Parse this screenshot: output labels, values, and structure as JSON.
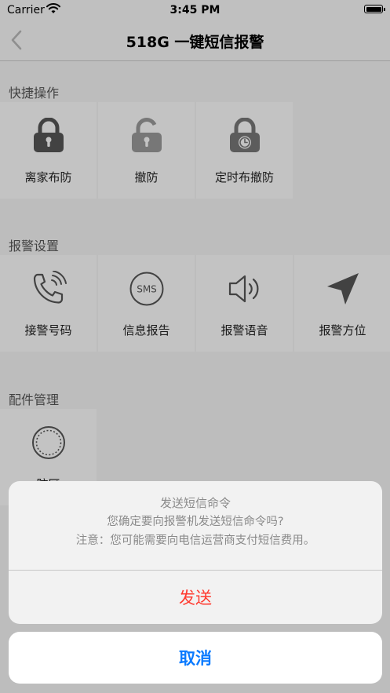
{
  "status_bar": {
    "carrier": "Carrier",
    "time": "3:45 PM"
  },
  "nav": {
    "title": "518G 一键短信报警"
  },
  "sections": {
    "quick": {
      "title": "快捷操作",
      "items": [
        {
          "label": "离家布防",
          "icon": "lock-closed-icon"
        },
        {
          "label": "撤防",
          "icon": "lock-open-icon"
        },
        {
          "label": "定时布撤防",
          "icon": "lock-timer-icon"
        }
      ]
    },
    "alarm": {
      "title": "报警设置",
      "items": [
        {
          "label": "接警号码",
          "icon": "phone-ringing-icon"
        },
        {
          "label": "信息报告",
          "icon": "sms-icon"
        },
        {
          "label": "报警语音",
          "icon": "speaker-icon"
        },
        {
          "label": "报警方位",
          "icon": "location-arrow-icon"
        }
      ]
    },
    "parts": {
      "title": "配件管理",
      "items": [
        {
          "label": "防区",
          "icon": "zone-ring-icon"
        }
      ]
    }
  },
  "action_sheet": {
    "title": "发送短信命令",
    "message_line1": "您确定要向报警机发送短信命令吗?",
    "message_line2": "注意：您可能需要向电信运营商支付短信费用。",
    "confirm_label": "发送",
    "cancel_label": "取消"
  },
  "colors": {
    "destructive": "#ff3b30",
    "accent": "#0a7aff",
    "icon_gray": "#555555"
  }
}
